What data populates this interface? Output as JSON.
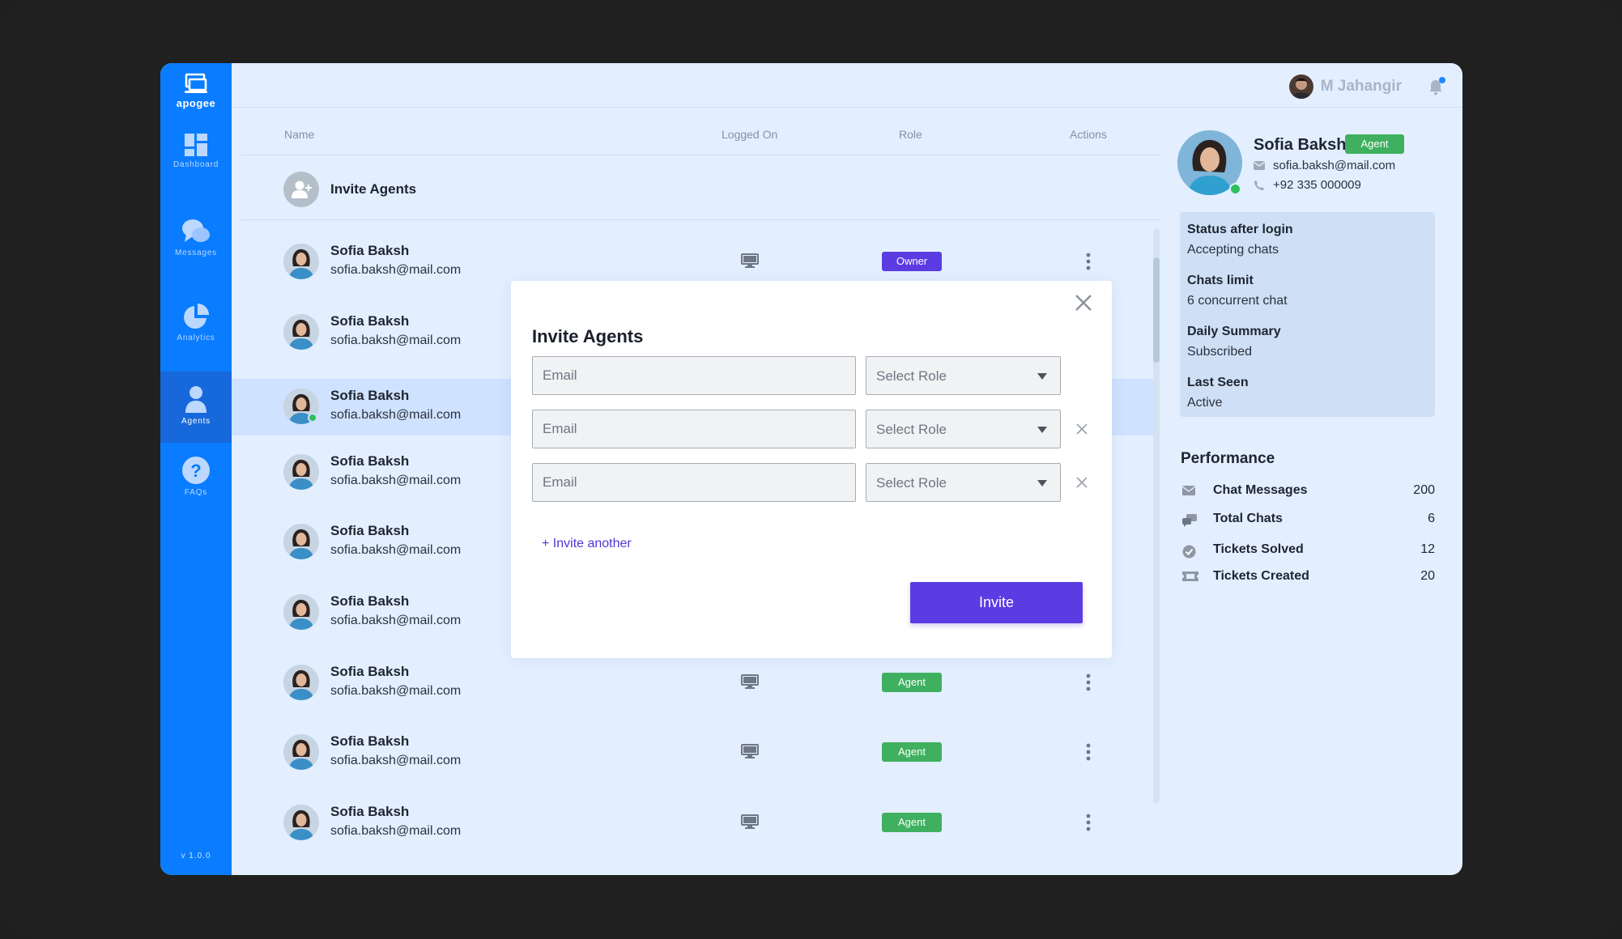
{
  "app": {
    "logo_text": "apogee",
    "version": "v 1.0.0"
  },
  "sidebar": {
    "items": [
      {
        "label": "Dashboard",
        "icon": "dashboard-icon"
      },
      {
        "label": "Messages",
        "icon": "messages-icon"
      },
      {
        "label": "Analytics",
        "icon": "analytics-icon"
      },
      {
        "label": "Agents",
        "icon": "agents-icon",
        "active": true
      },
      {
        "label": "FAQs",
        "icon": "faq-icon"
      }
    ]
  },
  "topbar": {
    "user_name": "M Jahangir"
  },
  "table": {
    "headers": {
      "name": "Name",
      "logged_on": "Logged On",
      "role": "Role",
      "actions": "Actions"
    },
    "invite_label": "Invite Agents",
    "rows": [
      {
        "name": "Sofia Baksh",
        "email": "sofia.baksh@mail.com",
        "role": "Owner"
      },
      {
        "name": "Sofia Baksh",
        "email": "sofia.baksh@mail.com",
        "role": ""
      },
      {
        "name": "Sofia Baksh",
        "email": "sofia.baksh@mail.com",
        "role": "",
        "selected": true
      },
      {
        "name": "Sofia Baksh",
        "email": "sofia.baksh@mail.com",
        "role": ""
      },
      {
        "name": "Sofia Baksh",
        "email": "sofia.baksh@mail.com",
        "role": ""
      },
      {
        "name": "Sofia Baksh",
        "email": "sofia.baksh@mail.com",
        "role": ""
      },
      {
        "name": "Sofia Baksh",
        "email": "sofia.baksh@mail.com",
        "role": "Agent"
      },
      {
        "name": "Sofia Baksh",
        "email": "sofia.baksh@mail.com",
        "role": "Agent"
      },
      {
        "name": "Sofia Baksh",
        "email": "sofia.baksh@mail.com",
        "role": "Agent"
      }
    ]
  },
  "profile": {
    "name": "Sofia Baksh",
    "role": "Agent",
    "email": "sofia.baksh@mail.com",
    "phone": "+92 335 000009",
    "details": [
      {
        "key": "Status after login",
        "value": "Accepting chats"
      },
      {
        "key": "Chats limit",
        "value": "6 concurrent chat"
      },
      {
        "key": "Daily Summary",
        "value": "Subscribed"
      },
      {
        "key": "Last Seen",
        "value": "Active"
      }
    ],
    "performance_title": "Performance",
    "performance": [
      {
        "label": "Chat Messages",
        "value": "200",
        "icon": "mail-icon"
      },
      {
        "label": "Total Chats",
        "value": "6",
        "icon": "chat-icon"
      },
      {
        "label": "Tickets Solved",
        "value": "12",
        "icon": "check-circle-icon"
      },
      {
        "label": "Tickets Created",
        "value": "20",
        "icon": "ticket-icon"
      }
    ]
  },
  "modal": {
    "title": "Invite Agents",
    "email_placeholder": "Email",
    "role_placeholder": "Select Role",
    "rows": 3,
    "invite_another": "+ Invite another",
    "invite_button": "Invite"
  },
  "colors": {
    "brand_blue": "#0a7cff",
    "accent_purple": "#5b3ce3",
    "agent_green": "#3fb060"
  }
}
